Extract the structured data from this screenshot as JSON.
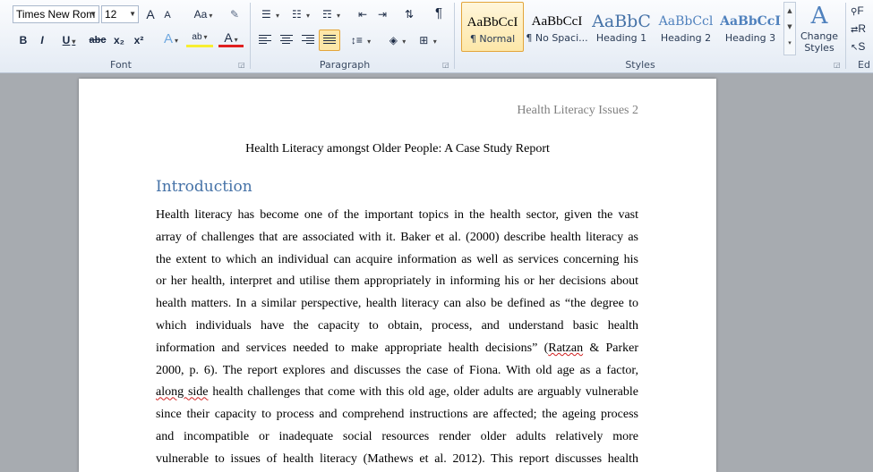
{
  "ribbon": {
    "font": {
      "group_label": "Font",
      "font_name": "Times New Rom",
      "font_size": "12",
      "grow_font": "A",
      "shrink_font": "A",
      "change_case": "Aa",
      "bold": "B",
      "italic": "I",
      "underline": "U",
      "strikethrough": "abc",
      "subscript": "x₂",
      "superscript": "x²",
      "text_effects": "A",
      "highlight": "ab",
      "font_color": "A"
    },
    "paragraph": {
      "group_label": "Paragraph",
      "pilcrow": "¶"
    },
    "styles": {
      "group_label": "Styles",
      "items": [
        {
          "preview": "AaBbCcI",
          "name": "¶ Normal"
        },
        {
          "preview": "AaBbCcI",
          "name": "¶ No Spaci..."
        },
        {
          "preview": "AaBbC",
          "name": "Heading 1"
        },
        {
          "preview": "AaBbCcl",
          "name": "Heading 2"
        },
        {
          "preview": "AaBbCcI",
          "name": "Heading 3"
        }
      ],
      "change_styles": "Change Styles"
    },
    "editing": {
      "group_label": "Ed",
      "find": "F",
      "replace": "R",
      "select": "S"
    }
  },
  "colors": {
    "heading": "#4572a7",
    "active_style": "#fde7a8"
  },
  "document": {
    "header": "Health Literacy Issues 2",
    "title": "Health Literacy amongst Older People: A Case Study Report",
    "heading": "Introduction",
    "lines": [
      "Health literacy has become one of the important topics in the health sector, given the vast",
      "array of challenges that are associated with it. Baker et al. (2000) describe health literacy as",
      "the extent to which an individual can acquire information as well as services concerning his",
      "or her health, interpret and utilise them appropriately in informing his or her decisions about",
      "health matters. In a similar perspective, health literacy can also be defined as “the degree to",
      "which individuals have the capacity to obtain, process, and understand basic health",
      "information and services needed to make appropriate health decisions” (Ratzan & Parker",
      "2000, p. 6). The report explores and discusses the case of Fiona. With old age as a factor,",
      "along side health challenges that come with this old age, older adults are arguably vulnerable",
      "since their capacity to process and comprehend instructions are affected; the ageing process",
      "and incompatible or inadequate social resources render older adults relatively more",
      "vulnerable to issues of health literacy (Mathews et al. 2012). This report discusses health"
    ]
  }
}
